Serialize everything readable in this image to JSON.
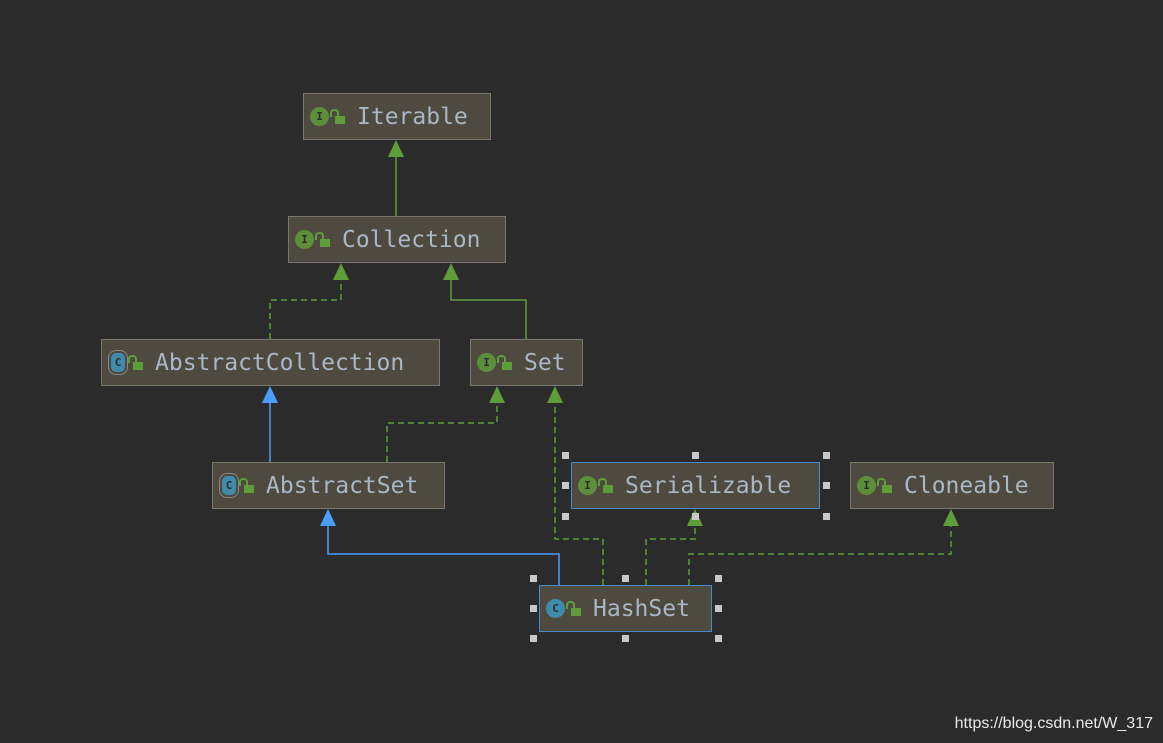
{
  "nodes": {
    "iterable": {
      "name": "Iterable",
      "kind": "interface",
      "badge": "I"
    },
    "collection": {
      "name": "Collection",
      "kind": "interface",
      "badge": "I"
    },
    "abstract_collection": {
      "name": "AbstractCollection",
      "kind": "abstract-class",
      "badge": "C"
    },
    "set": {
      "name": "Set",
      "kind": "interface",
      "badge": "I"
    },
    "abstract_set": {
      "name": "AbstractSet",
      "kind": "abstract-class",
      "badge": "C"
    },
    "serializable": {
      "name": "Serializable",
      "kind": "interface",
      "badge": "I",
      "selected": true
    },
    "cloneable": {
      "name": "Cloneable",
      "kind": "interface",
      "badge": "I"
    },
    "hash_set": {
      "name": "HashSet",
      "kind": "class",
      "badge": "C",
      "selected": true
    }
  },
  "edges": [
    {
      "from": "Collection",
      "to": "Iterable",
      "type": "extends"
    },
    {
      "from": "AbstractCollection",
      "to": "Collection",
      "type": "implements"
    },
    {
      "from": "Set",
      "to": "Collection",
      "type": "extends"
    },
    {
      "from": "AbstractSet",
      "to": "AbstractCollection",
      "type": "class-extends"
    },
    {
      "from": "AbstractSet",
      "to": "Set",
      "type": "implements"
    },
    {
      "from": "HashSet",
      "to": "AbstractSet",
      "type": "class-extends"
    },
    {
      "from": "HashSet",
      "to": "Set",
      "type": "implements"
    },
    {
      "from": "HashSet",
      "to": "Serializable",
      "type": "implements"
    },
    {
      "from": "HashSet",
      "to": "Cloneable",
      "type": "implements"
    }
  ],
  "colors": {
    "background": "#2b2b2b",
    "node": "#4e4a3f",
    "interface_edge": "#5d9e3a",
    "class_edge": "#4a9eff",
    "selection": "#4a88c7"
  },
  "watermark": "https://blog.csdn.net/W_317"
}
